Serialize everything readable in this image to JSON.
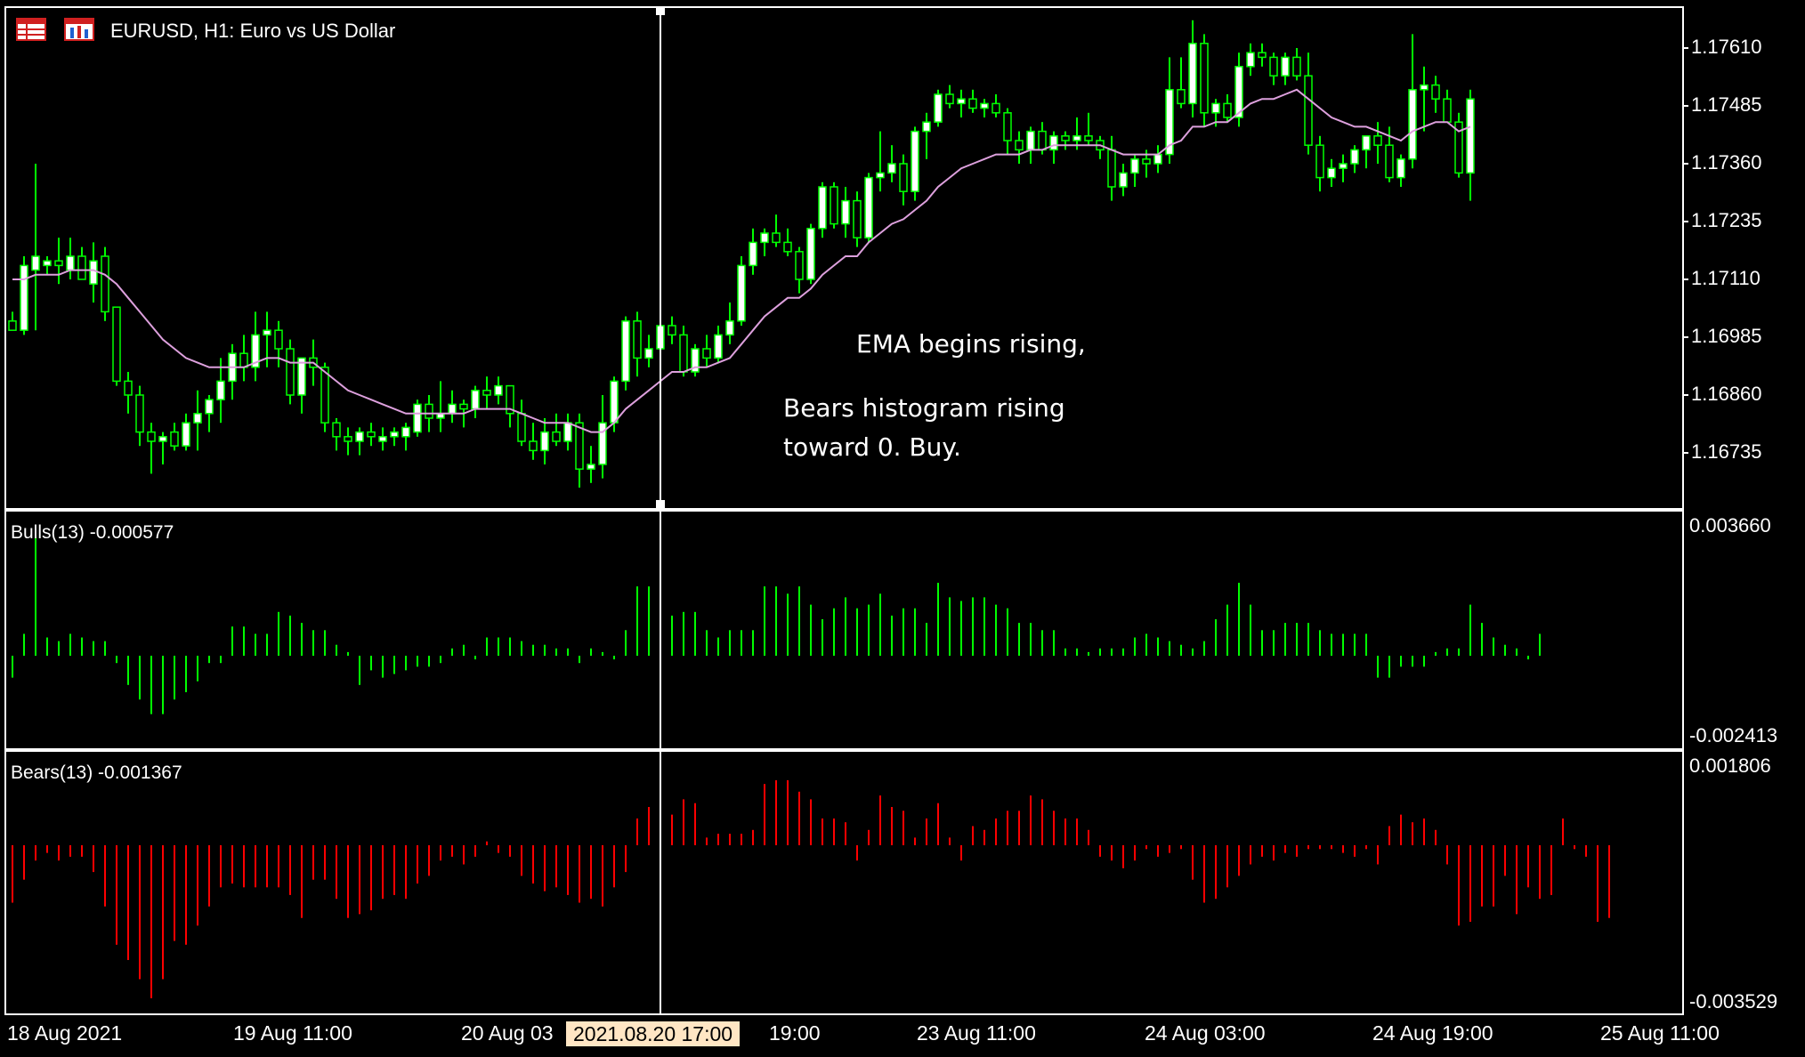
{
  "header": {
    "title": "EURUSD, H1:  Euro vs US Dollar",
    "icons": [
      "table-icon",
      "chart-window-icon"
    ]
  },
  "colors": {
    "background": "#000000",
    "bull_candle": "#ffffff",
    "bear_candle": "#000000",
    "candle_wick": "#00ff00",
    "ema": "#dda0dd",
    "bulls_histogram": "#00ff00",
    "bears_histogram": "#ff0000",
    "panel_border": "#ffffff",
    "crosshair": "#ffffff",
    "time_highlight_bg": "#ffe6c4"
  },
  "price_axis": [
    "1.17610",
    "1.17485",
    "1.17360",
    "1.17235",
    "1.17110",
    "1.16985",
    "1.16860",
    "1.16735"
  ],
  "bulls_panel": {
    "label": "Bulls(13) -0.000577",
    "axis_max": "0.003660",
    "axis_min": "-0.002413"
  },
  "bears_panel": {
    "label": "Bears(13) -0.001367",
    "axis_max": "0.001806",
    "axis_min": "-0.003529"
  },
  "time_axis": [
    "18 Aug 2021",
    "19 Aug 11:00",
    "20 Aug 03",
    "19:00",
    "23 Aug 11:00",
    "24 Aug 03:00",
    "24 Aug 19:00",
    "25 Aug 11:00"
  ],
  "crosshair_time": "2021.08.20 17:00",
  "annotation": {
    "line1": "EMA begins rising,",
    "line2": "Bears histogram rising",
    "line3": "toward 0. Buy."
  },
  "chart_data": {
    "type": "candlestick",
    "symbol": "EURUSD",
    "timeframe": "H1",
    "ylim": [
      1.1664,
      1.1781
    ],
    "candles": [
      [
        1.1702,
        1.1704,
        1.17,
        1.17
      ],
      [
        1.17,
        1.1716,
        1.1699,
        1.1714
      ],
      [
        1.1713,
        1.1736,
        1.17,
        1.1716
      ],
      [
        1.1714,
        1.1716,
        1.1712,
        1.1715
      ],
      [
        1.1715,
        1.172,
        1.171,
        1.1714
      ],
      [
        1.1713,
        1.172,
        1.1711,
        1.1716
      ],
      [
        1.1716,
        1.1718,
        1.1712,
        1.1711
      ],
      [
        1.171,
        1.1719,
        1.1706,
        1.1715
      ],
      [
        1.1716,
        1.1718,
        1.1702,
        1.1704
      ],
      [
        1.1705,
        1.1705,
        1.1688,
        1.1689
      ],
      [
        1.1689,
        1.1691,
        1.1682,
        1.1686
      ],
      [
        1.1686,
        1.1688,
        1.1675,
        1.1678
      ],
      [
        1.1678,
        1.168,
        1.1669,
        1.1676
      ],
      [
        1.1676,
        1.1678,
        1.1671,
        1.1677
      ],
      [
        1.1678,
        1.168,
        1.1674,
        1.1675
      ],
      [
        1.1675,
        1.1682,
        1.1674,
        1.168
      ],
      [
        1.168,
        1.1687,
        1.1674,
        1.1682
      ],
      [
        1.1682,
        1.1686,
        1.1678,
        1.1685
      ],
      [
        1.1685,
        1.1694,
        1.168,
        1.1689
      ],
      [
        1.1689,
        1.1697,
        1.1685,
        1.1695
      ],
      [
        1.1695,
        1.1699,
        1.1689,
        1.1692
      ],
      [
        1.1692,
        1.1704,
        1.1689,
        1.1699
      ],
      [
        1.1699,
        1.1704,
        1.1692,
        1.17
      ],
      [
        1.17,
        1.1702,
        1.1692,
        1.1696
      ],
      [
        1.1696,
        1.1698,
        1.1684,
        1.1686
      ],
      [
        1.1686,
        1.1694,
        1.1682,
        1.1694
      ],
      [
        1.1694,
        1.1698,
        1.1688,
        1.1692
      ],
      [
        1.1692,
        1.1693,
        1.1678,
        1.168
      ],
      [
        1.168,
        1.1681,
        1.1674,
        1.1677
      ],
      [
        1.1677,
        1.1679,
        1.1673,
        1.1676
      ],
      [
        1.1676,
        1.1679,
        1.1673,
        1.1678
      ],
      [
        1.1678,
        1.168,
        1.1675,
        1.1677
      ],
      [
        1.1676,
        1.1679,
        1.1674,
        1.1677
      ],
      [
        1.1677,
        1.1679,
        1.1675,
        1.1678
      ],
      [
        1.1677,
        1.168,
        1.1674,
        1.1679
      ],
      [
        1.1678,
        1.1685,
        1.1677,
        1.1684
      ],
      [
        1.1684,
        1.1686,
        1.1678,
        1.1681
      ],
      [
        1.1681,
        1.1689,
        1.1678,
        1.1682
      ],
      [
        1.1682,
        1.1687,
        1.168,
        1.1684
      ],
      [
        1.1684,
        1.1685,
        1.1679,
        1.1683
      ],
      [
        1.1683,
        1.1688,
        1.1681,
        1.1687
      ],
      [
        1.1687,
        1.169,
        1.1683,
        1.1686
      ],
      [
        1.1686,
        1.169,
        1.1684,
        1.1688
      ],
      [
        1.1688,
        1.1688,
        1.1679,
        1.1682
      ],
      [
        1.1682,
        1.1685,
        1.1675,
        1.1676
      ],
      [
        1.1676,
        1.168,
        1.1672,
        1.1674
      ],
      [
        1.1674,
        1.1681,
        1.1671,
        1.1678
      ],
      [
        1.1678,
        1.1682,
        1.1675,
        1.1676
      ],
      [
        1.1676,
        1.1682,
        1.1674,
        1.168
      ],
      [
        1.168,
        1.1682,
        1.1666,
        1.167
      ],
      [
        1.167,
        1.1675,
        1.1667,
        1.1671
      ],
      [
        1.1671,
        1.1686,
        1.1668,
        1.168
      ],
      [
        1.168,
        1.169,
        1.1678,
        1.1689
      ],
      [
        1.1689,
        1.1703,
        1.1687,
        1.1702
      ],
      [
        1.1702,
        1.1704,
        1.169,
        1.1694
      ],
      [
        1.1694,
        1.1699,
        1.1692,
        1.1696
      ],
      [
        1.1696,
        1.1702,
        1.1694,
        1.1701
      ],
      [
        1.1701,
        1.1703,
        1.1697,
        1.1699
      ],
      [
        1.1699,
        1.1701,
        1.169,
        1.1691
      ],
      [
        1.1691,
        1.1697,
        1.169,
        1.1696
      ],
      [
        1.1696,
        1.1699,
        1.1692,
        1.1694
      ],
      [
        1.1694,
        1.1701,
        1.1693,
        1.1699
      ],
      [
        1.1699,
        1.1706,
        1.1697,
        1.1702
      ],
      [
        1.1702,
        1.1716,
        1.1701,
        1.1714
      ],
      [
        1.1714,
        1.1722,
        1.1712,
        1.1719
      ],
      [
        1.1719,
        1.1722,
        1.1716,
        1.1721
      ],
      [
        1.1721,
        1.1725,
        1.1718,
        1.1719
      ],
      [
        1.1719,
        1.1722,
        1.1716,
        1.1717
      ],
      [
        1.1717,
        1.1718,
        1.1708,
        1.1711
      ],
      [
        1.1711,
        1.1723,
        1.171,
        1.1722
      ],
      [
        1.1722,
        1.1732,
        1.172,
        1.1731
      ],
      [
        1.1731,
        1.1732,
        1.1722,
        1.1723
      ],
      [
        1.1723,
        1.1731,
        1.172,
        1.1728
      ],
      [
        1.1728,
        1.173,
        1.1718,
        1.172
      ],
      [
        1.172,
        1.1734,
        1.1719,
        1.1733
      ],
      [
        1.1733,
        1.1743,
        1.173,
        1.1734
      ],
      [
        1.1734,
        1.174,
        1.1732,
        1.1736
      ],
      [
        1.1736,
        1.1738,
        1.1727,
        1.173
      ],
      [
        1.173,
        1.1744,
        1.1728,
        1.1743
      ],
      [
        1.1743,
        1.1747,
        1.1737,
        1.1745
      ],
      [
        1.1745,
        1.1752,
        1.1744,
        1.1751
      ],
      [
        1.1751,
        1.1753,
        1.1748,
        1.1749
      ],
      [
        1.1749,
        1.1752,
        1.1746,
        1.175
      ],
      [
        1.175,
        1.1752,
        1.1747,
        1.1748
      ],
      [
        1.1748,
        1.175,
        1.1746,
        1.1749
      ],
      [
        1.1749,
        1.1751,
        1.1746,
        1.1747
      ],
      [
        1.1747,
        1.1748,
        1.1738,
        1.1741
      ],
      [
        1.1741,
        1.1743,
        1.1736,
        1.1739
      ],
      [
        1.1739,
        1.1744,
        1.1736,
        1.1743
      ],
      [
        1.1743,
        1.1745,
        1.1738,
        1.1739
      ],
      [
        1.1739,
        1.1743,
        1.1736,
        1.1742
      ],
      [
        1.1742,
        1.1743,
        1.1739,
        1.1741
      ],
      [
        1.1741,
        1.1746,
        1.1739,
        1.1742
      ],
      [
        1.1742,
        1.1747,
        1.174,
        1.1741
      ],
      [
        1.1741,
        1.1742,
        1.1737,
        1.1739
      ],
      [
        1.1739,
        1.1742,
        1.1728,
        1.1731
      ],
      [
        1.1731,
        1.1736,
        1.1729,
        1.1734
      ],
      [
        1.1734,
        1.1738,
        1.1731,
        1.1737
      ],
      [
        1.1737,
        1.1739,
        1.1733,
        1.1736
      ],
      [
        1.1736,
        1.174,
        1.1734,
        1.1738
      ],
      [
        1.1738,
        1.1759,
        1.1736,
        1.1752
      ],
      [
        1.1752,
        1.1759,
        1.1748,
        1.1749
      ],
      [
        1.1749,
        1.1767,
        1.1746,
        1.1762
      ],
      [
        1.1762,
        1.1764,
        1.1744,
        1.1747
      ],
      [
        1.1747,
        1.175,
        1.1744,
        1.1749
      ],
      [
        1.1749,
        1.1751,
        1.1745,
        1.1746
      ],
      [
        1.1746,
        1.176,
        1.1744,
        1.1757
      ],
      [
        1.1757,
        1.1762,
        1.1755,
        1.176
      ],
      [
        1.176,
        1.1762,
        1.1757,
        1.1759
      ],
      [
        1.1759,
        1.176,
        1.1753,
        1.1755
      ],
      [
        1.1755,
        1.176,
        1.1753,
        1.1759
      ],
      [
        1.1759,
        1.1761,
        1.1754,
        1.1755
      ],
      [
        1.1755,
        1.176,
        1.1738,
        1.174
      ],
      [
        1.174,
        1.1742,
        1.173,
        1.1733
      ],
      [
        1.1733,
        1.1737,
        1.1731,
        1.1735
      ],
      [
        1.1735,
        1.1738,
        1.1732,
        1.1736
      ],
      [
        1.1736,
        1.174,
        1.1734,
        1.1739
      ],
      [
        1.1739,
        1.1741,
        1.1735,
        1.1742
      ],
      [
        1.1742,
        1.1745,
        1.1736,
        1.174
      ],
      [
        1.174,
        1.1744,
        1.1732,
        1.1733
      ],
      [
        1.1733,
        1.1738,
        1.1731,
        1.1737
      ],
      [
        1.1737,
        1.1764,
        1.1735,
        1.1752
      ],
      [
        1.1752,
        1.1757,
        1.1743,
        1.1753
      ],
      [
        1.1753,
        1.1755,
        1.1747,
        1.175
      ],
      [
        1.175,
        1.1752,
        1.1745,
        1.1745
      ],
      [
        1.1745,
        1.1747,
        1.1733,
        1.1734
      ],
      [
        1.1734,
        1.1752,
        1.1728,
        1.175
      ]
    ],
    "ema": [
      1.1711,
      1.1711,
      1.1712,
      1.1712,
      1.1712,
      1.1713,
      1.1713,
      1.1713,
      1.1712,
      1.171,
      1.1707,
      1.1704,
      1.1701,
      1.1698,
      1.1696,
      1.1694,
      1.1693,
      1.1692,
      1.1692,
      1.1692,
      1.1692,
      1.1693,
      1.1694,
      1.1694,
      1.1693,
      1.1693,
      1.1693,
      1.1691,
      1.1689,
      1.1687,
      1.1686,
      1.1685,
      1.1684,
      1.1683,
      1.1682,
      1.1682,
      1.1682,
      1.1682,
      1.1682,
      1.1682,
      1.1683,
      1.1683,
      1.1683,
      1.1683,
      1.1682,
      1.1681,
      1.168,
      1.168,
      1.168,
      1.1679,
      1.1678,
      1.1678,
      1.168,
      1.1683,
      1.1685,
      1.1687,
      1.1689,
      1.1691,
      1.1691,
      1.1692,
      1.1692,
      1.1693,
      1.1694,
      1.1697,
      1.17,
      1.1703,
      1.1705,
      1.1707,
      1.1707,
      1.1709,
      1.1712,
      1.1714,
      1.1716,
      1.1716,
      1.1719,
      1.1721,
      1.1723,
      1.1724,
      1.1726,
      1.1728,
      1.1731,
      1.1733,
      1.1735,
      1.1736,
      1.1737,
      1.1738,
      1.1738,
      1.1738,
      1.1739,
      1.1739,
      1.174,
      1.174,
      1.174,
      1.174,
      1.174,
      1.1739,
      1.1738,
      1.1738,
      1.1738,
      1.1738,
      1.174,
      1.1741,
      1.1744,
      1.1744,
      1.1745,
      1.1745,
      1.1747,
      1.1749,
      1.175,
      1.175,
      1.1751,
      1.1752,
      1.175,
      1.1748,
      1.1746,
      1.1745,
      1.1744,
      1.1744,
      1.1743,
      1.1742,
      1.1741,
      1.1743,
      1.1744,
      1.1745,
      1.1745,
      1.1743,
      1.1744
    ],
    "bulls": [
      -0.0006,
      0.0006,
      0.0033,
      0.0005,
      0.0004,
      0.0006,
      0.0005,
      0.0004,
      0.0004,
      -0.0002,
      -0.0008,
      -0.0012,
      -0.0016,
      -0.0016,
      -0.0012,
      -0.001,
      -0.0007,
      -0.0002,
      -0.0002,
      0.0008,
      0.0008,
      0.0006,
      0.0006,
      0.0012,
      0.0011,
      0.0009,
      0.0007,
      0.0007,
      0.0003,
      0.0001,
      -0.0008,
      -0.0004,
      -0.0006,
      -0.0005,
      -0.0004,
      -0.0003,
      -0.0003,
      -0.0002,
      0.0002,
      0.0003,
      -0.0001,
      0.0005,
      0.0005,
      0.0005,
      0.0004,
      0.0003,
      0.0003,
      0.0002,
      0.0002,
      -0.0002,
      0.0002,
      0.0001,
      -0.0001,
      0.0007,
      0.0019,
      0.0019,
      0.0014,
      0.0011,
      0.0012,
      0.0012,
      0.0007,
      0.0005,
      0.0007,
      0.0007,
      0.0007,
      0.0019,
      0.0019,
      0.0017,
      0.0019,
      0.0014,
      0.001,
      0.0013,
      0.0016,
      0.0013,
      0.0014,
      0.0017,
      0.0011,
      0.0013,
      0.0013,
      0.0009,
      0.002,
      0.0016,
      0.0015,
      0.0016,
      0.0016,
      0.0014,
      0.0013,
      0.0009,
      0.0009,
      0.0007,
      0.0007,
      0.0002,
      0.0002,
      0.0001,
      0.0002,
      0.0002,
      0.0002,
      0.0005,
      0.0006,
      0.0005,
      0.0004,
      0.0003,
      0.0002,
      0.0004,
      0.001,
      0.0014,
      0.002,
      0.0014,
      0.0007,
      0.0007,
      0.0009,
      0.0009,
      0.0009,
      0.0007,
      0.0006,
      0.0006,
      0.0006,
      0.0006,
      -0.0006,
      -0.0006,
      -0.0003,
      -0.0003,
      -0.0003,
      0.0001,
      0.0002,
      0.0002,
      0.0014,
      0.0009,
      0.0005,
      0.0003,
      0.0002,
      -0.0001,
      0.0006
    ],
    "bears": [
      -0.0015,
      -0.0009,
      -0.0004,
      -0.0002,
      -0.0004,
      -0.0003,
      -0.0003,
      -0.0007,
      -0.0016,
      -0.0026,
      -0.003,
      -0.0035,
      -0.004,
      -0.0035,
      -0.0025,
      -0.0026,
      -0.0021,
      -0.0016,
      -0.0011,
      -0.001,
      -0.0011,
      -0.0011,
      -0.0011,
      -0.0011,
      -0.0013,
      -0.0019,
      -0.0009,
      -0.0009,
      -0.0014,
      -0.0019,
      -0.0018,
      -0.0017,
      -0.0014,
      -0.0013,
      -0.0014,
      -0.001,
      -0.0008,
      -0.0004,
      -0.0003,
      -0.0005,
      -0.0003,
      0.0001,
      -0.0002,
      -0.0003,
      -0.0008,
      -0.001,
      -0.0012,
      -0.0011,
      -0.0013,
      -0.0015,
      -0.0014,
      -0.0016,
      -0.0011,
      -0.0007,
      0.0007,
      0.001,
      0.0007,
      0.0008,
      0.0012,
      0.0011,
      0.0002,
      0.0003,
      0.0003,
      0.0003,
      0.0004,
      0.0016,
      0.0017,
      0.0017,
      0.0014,
      0.0012,
      0.0007,
      0.0007,
      0.0006,
      -0.0004,
      0.0004,
      0.0013,
      0.001,
      0.0009,
      0.0002,
      0.0007,
      0.0011,
      0.0002,
      -0.0004,
      0.0005,
      0.0004,
      0.0007,
      0.0009,
      0.0009,
      0.0013,
      0.0012,
      0.0009,
      0.0007,
      0.0007,
      0.0004,
      -0.0003,
      -0.0004,
      -0.0006,
      -0.0004,
      -0.0001,
      -0.0003,
      -0.0002,
      -0.0001,
      -0.0009,
      -0.0015,
      -0.0014,
      -0.0011,
      -0.0008,
      -0.0005,
      -0.0003,
      -0.0004,
      -0.0002,
      -0.0003,
      -0.0001,
      -0.0001,
      -0.0001,
      -0.0002,
      -0.0003,
      -0.0001,
      -0.0005,
      0.0005,
      0.0008,
      0.0006,
      0.0007,
      0.0004,
      -0.0005,
      -0.0021,
      -0.002,
      -0.0016,
      -0.0016,
      -0.0008,
      -0.0018,
      -0.0011,
      -0.0014,
      -0.0013,
      0.0007,
      -0.0001,
      -0.0003,
      -0.002,
      -0.0019
    ]
  }
}
